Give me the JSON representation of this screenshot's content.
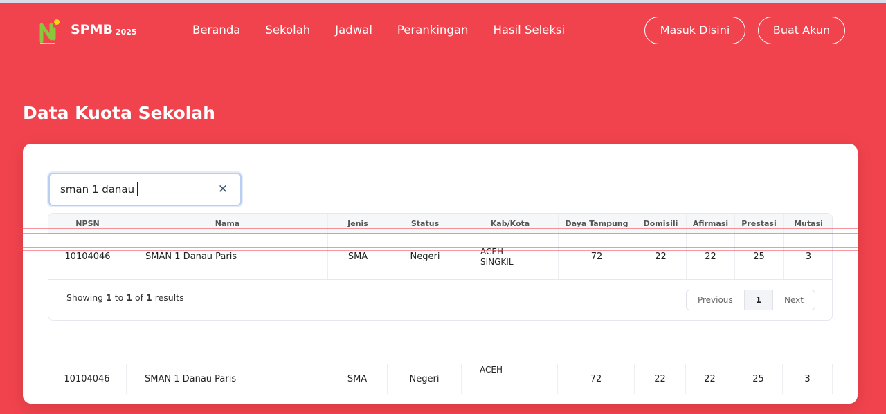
{
  "header": {
    "brand": "SPMB",
    "year": "2025",
    "nav": [
      "Beranda",
      "Sekolah",
      "Jadwal",
      "Perankingan",
      "Hasil Seleksi"
    ],
    "login_label": "Masuk Disini",
    "register_label": "Buat Akun"
  },
  "page_title": "Data Kuota Sekolah",
  "search": {
    "value": "sman 1 danau"
  },
  "table": {
    "columns": [
      "NPSN",
      "Nama",
      "Jenis",
      "Status",
      "Kab/Kota",
      "Daya Tampung",
      "Domisili",
      "Afirmasi",
      "Prestasi",
      "Mutasi"
    ],
    "rows": [
      {
        "npsn": "10104046",
        "nama": "SMAN 1 Danau Paris",
        "jenis": "SMA",
        "status": "Negeri",
        "kab_line1": "ACEH",
        "kab_line2": "SINGKIL",
        "daya_tampung": "72",
        "domisili": "22",
        "afirmasi": "22",
        "prestasi": "25",
        "mutasi": "3"
      }
    ]
  },
  "pagination": {
    "showing_prefix": "Showing",
    "from": "1",
    "to_word": "to",
    "to": "1",
    "of_word": "of",
    "total": "1",
    "suffix": "results",
    "previous": "Previous",
    "current": "1",
    "next": "Next"
  },
  "duplicate_row": {
    "npsn": "10104046",
    "nama": "SMAN 1 Danau Paris",
    "jenis": "SMA",
    "status": "Negeri",
    "kab_line1": "ACEH",
    "daya_tampung": "72",
    "domisili": "22",
    "afirmasi": "22",
    "prestasi": "25",
    "mutasi": "3"
  },
  "colors": {
    "brand_red": "#f1434d",
    "logo_green": "#8cc63f",
    "logo_yellow": "#f7d417"
  }
}
